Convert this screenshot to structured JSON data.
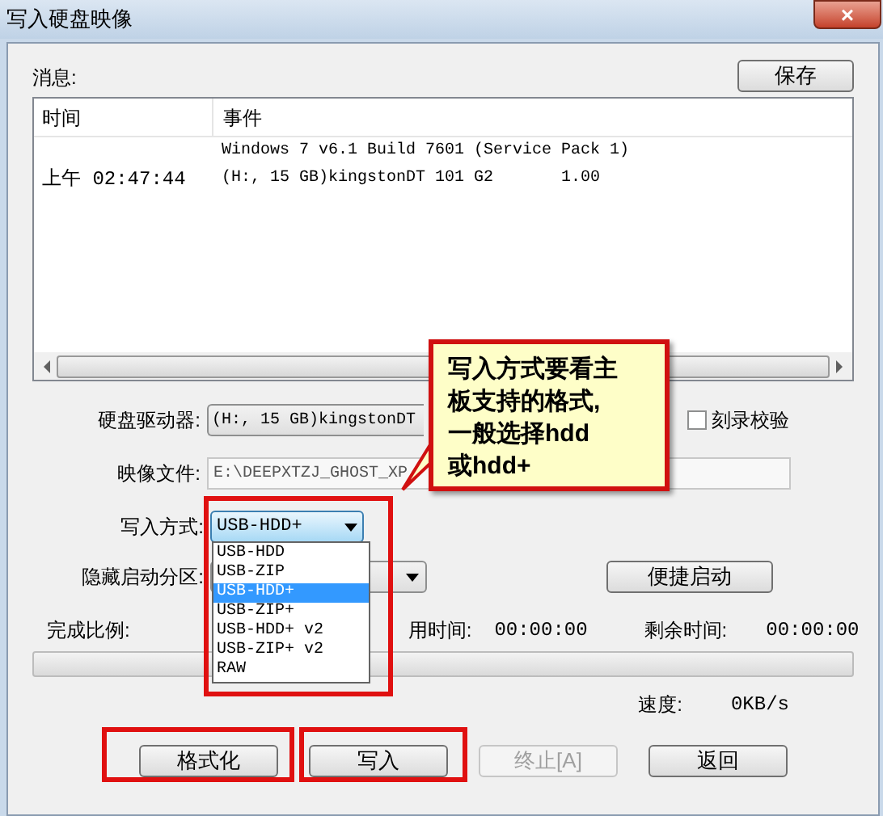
{
  "window": {
    "title": "写入硬盘映像",
    "close": "×"
  },
  "messages": {
    "label": "消息:",
    "save_button": "保存"
  },
  "log": {
    "columns": [
      "时间",
      "事件"
    ],
    "rows": [
      {
        "event": "Windows 7 v6.1 Build 7601 (Service Pack 1)"
      },
      {
        "time": "上午 02:47:44",
        "event": "(H:, 15 GB)kingstonDT 101 G2       1.00"
      }
    ]
  },
  "drive": {
    "label": "硬盘驱动器:",
    "value": "(H:, 15 GB)kingstonDT"
  },
  "verify": {
    "label": "刻录校验",
    "checked": false
  },
  "image_file": {
    "label": "映像文件:",
    "value": "E:\\DEEPXTZJ_GHOST_XP"
  },
  "write_mode": {
    "label": "写入方式:",
    "value": "USB-HDD+",
    "options": [
      {
        "label": "USB-HDD",
        "selected": false
      },
      {
        "label": "USB-ZIP",
        "selected": false
      },
      {
        "label": "USB-HDD+",
        "selected": true
      },
      {
        "label": "USB-ZIP+",
        "selected": false
      },
      {
        "label": "USB-HDD+ v2",
        "selected": false
      },
      {
        "label": "USB-ZIP+ v2",
        "selected": false
      },
      {
        "label": "RAW",
        "selected": false
      }
    ]
  },
  "hidden_partition": {
    "label": "隐藏启动分区:"
  },
  "quick_boot_button": "便捷启动",
  "progress": {
    "label": "完成比例:",
    "elapsed_label": "用时间:",
    "elapsed": "00:00:00",
    "remaining_label": "剩余时间:",
    "remaining": "00:00:00",
    "level": 0
  },
  "speed": {
    "label": "速度:",
    "value": "0KB/s"
  },
  "buttons": [
    {
      "label": "格式化",
      "disabled": false,
      "highlighted": true
    },
    {
      "label": "写入",
      "disabled": false,
      "highlighted": true
    },
    {
      "label": "终止[A]",
      "disabled": true,
      "highlighted": false
    },
    {
      "label": "返回",
      "disabled": false,
      "highlighted": false
    }
  ],
  "callout": {
    "lines": [
      "写入方式要看主",
      "板支持的格式,",
      "一般选择hdd",
      "或hdd+"
    ]
  }
}
